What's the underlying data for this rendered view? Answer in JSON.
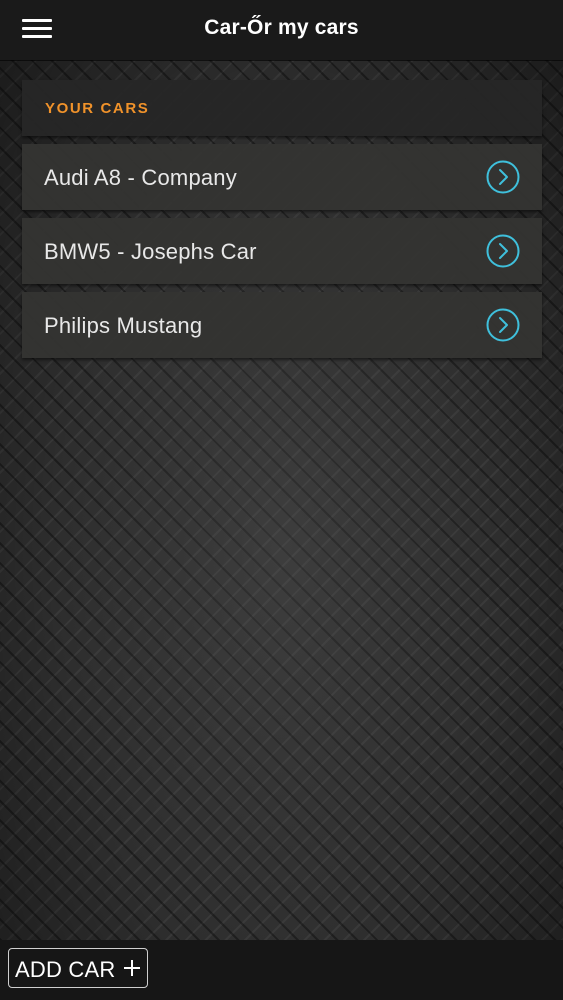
{
  "header": {
    "title": "Car-Őr my cars",
    "menu_icon": "hamburger-menu-icon"
  },
  "section": {
    "label": "YOUR CARS"
  },
  "cars": [
    {
      "name": "Audi A8 - Company",
      "icon": "chevron-right-circle-icon"
    },
    {
      "name": "BMW5 - Josephs Car",
      "icon": "chevron-right-circle-icon"
    },
    {
      "name": "Philips Mustang",
      "icon": "chevron-right-circle-icon"
    }
  ],
  "footer": {
    "add_label": "ADD CAR",
    "add_icon": "plus-icon"
  },
  "colors": {
    "accent_orange": "#f0922a",
    "arrow_cyan": "#3fc0dc",
    "header_bg": "#1a1a1a",
    "row_bg": "#343432"
  }
}
